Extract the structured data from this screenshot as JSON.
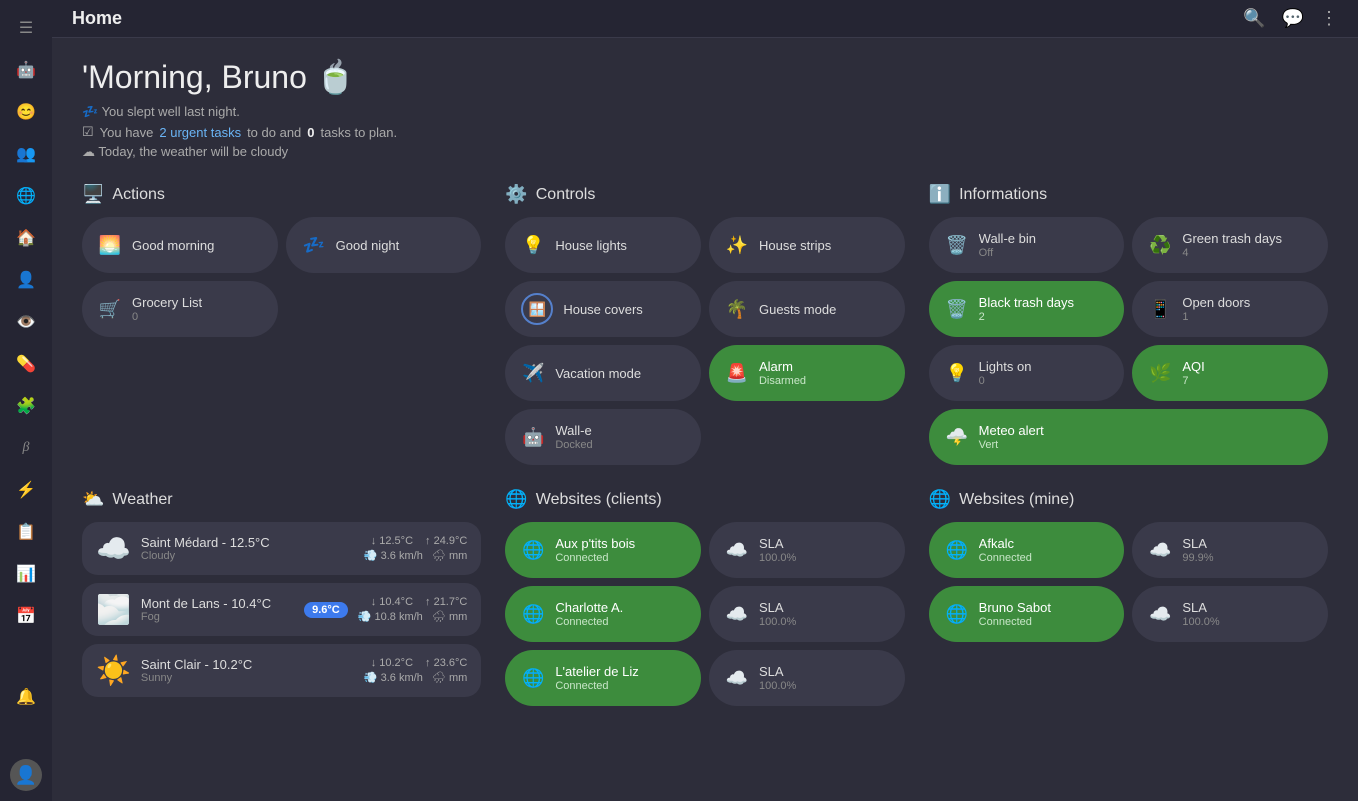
{
  "header": {
    "title": "Home"
  },
  "greeting": {
    "title": "'Morning, Bruno 🍵",
    "sleep_line": "💤 You slept well last night.",
    "tasks_line_prefix": "You have ",
    "tasks_link": "2 urgent tasks",
    "tasks_line_suffix": " to do and ",
    "tasks_count": "0",
    "tasks_line_end": " tasks to plan.",
    "weather_line": "☁ Today, the weather will be cloudy"
  },
  "sections": {
    "actions": {
      "title": "Actions",
      "tiles": [
        {
          "icon": "🌅",
          "label": "Good morning",
          "sublabel": "",
          "green": false
        },
        {
          "icon": "💤",
          "label": "Good night",
          "sublabel": "",
          "green": false
        },
        {
          "icon": "🛒",
          "label": "Grocery List",
          "sublabel": "0",
          "green": false
        }
      ]
    },
    "controls": {
      "title": "Controls",
      "tiles": [
        {
          "icon": "💡",
          "label": "House lights",
          "sublabel": "",
          "green": false,
          "ring": false
        },
        {
          "icon": "✨",
          "label": "House strips",
          "sublabel": "",
          "green": false,
          "ring": false
        },
        {
          "icon": "🪟",
          "label": "House covers",
          "sublabel": "",
          "green": false,
          "ring": true
        },
        {
          "icon": "🌴",
          "label": "Guests mode",
          "sublabel": "",
          "green": false,
          "ring": false
        },
        {
          "icon": "✈️",
          "label": "Vacation mode",
          "sublabel": "",
          "green": false,
          "ring": false
        },
        {
          "icon": "🚨",
          "label": "Alarm",
          "sublabel": "Disarmed",
          "green": true,
          "ring": false
        },
        {
          "icon": "🤖",
          "label": "Wall-e",
          "sublabel": "Docked",
          "green": false,
          "ring": false
        }
      ]
    },
    "informations": {
      "title": "Informations",
      "tiles": [
        {
          "icon": "🗑️",
          "label": "Wall-e bin",
          "sublabel": "Off",
          "green": false
        },
        {
          "icon": "♻️",
          "label": "Green trash days",
          "sublabel": "4",
          "green": false
        },
        {
          "icon": "🗑️",
          "label": "Black trash days",
          "sublabel": "2",
          "green": true
        },
        {
          "icon": "📱",
          "label": "Open doors",
          "sublabel": "1",
          "green": false
        },
        {
          "icon": "💡",
          "label": "Lights on",
          "sublabel": "0",
          "green": false
        },
        {
          "icon": "🌿",
          "label": "AQI",
          "sublabel": "7",
          "green": true
        },
        {
          "icon": "🌩️",
          "label": "Meteo alert",
          "sublabel": "Vert",
          "green": true
        }
      ]
    },
    "weather": {
      "title": "Weather",
      "items": [
        {
          "icon": "☁️",
          "name": "Saint Médard  - 12.5°C",
          "condition": "Cloudy",
          "badge": "",
          "temp_low": "12.5°C",
          "temp_high": "24.9°C",
          "wind": "3.6 km/h",
          "rain": "mm"
        },
        {
          "icon": "🌫️",
          "name": "Mont de Lans  - 10.4°C",
          "condition": "Fog",
          "badge": "9.6°C",
          "temp_low": "10.4°C",
          "temp_high": "21.7°C",
          "wind": "10.8 km/h",
          "rain": "mm"
        },
        {
          "icon": "☀️",
          "name": "Saint Clair  - 10.2°C",
          "condition": "Sunny",
          "badge": "",
          "temp_low": "10.2°C",
          "temp_high": "23.6°C",
          "wind": "3.6 km/h",
          "rain": "mm"
        }
      ]
    },
    "websites_clients": {
      "title": "Websites (clients)",
      "tiles": [
        {
          "icon": "🌐",
          "label": "Aux p'tits bois",
          "sublabel": "Connected",
          "green": true
        },
        {
          "icon": "☁️",
          "label": "SLA",
          "sublabel": "100.0%",
          "green": false
        },
        {
          "icon": "🌐",
          "label": "Charlotte A.",
          "sublabel": "Connected",
          "green": true
        },
        {
          "icon": "☁️",
          "label": "SLA",
          "sublabel": "100.0%",
          "green": false
        },
        {
          "icon": "🌐",
          "label": "L'atelier de Liz",
          "sublabel": "Connected",
          "green": true
        },
        {
          "icon": "☁️",
          "label": "SLA",
          "sublabel": "100.0%",
          "green": false
        }
      ]
    },
    "websites_mine": {
      "title": "Websites (mine)",
      "tiles": [
        {
          "icon": "🌐",
          "label": "Afkalc",
          "sublabel": "Connected",
          "green": true
        },
        {
          "icon": "☁️",
          "label": "SLA",
          "sublabel": "99.9%",
          "green": false
        },
        {
          "icon": "🌐",
          "label": "Bruno Sabot",
          "sublabel": "Connected",
          "green": true
        },
        {
          "icon": "☁️",
          "label": "SLA",
          "sublabel": "100.0%",
          "green": false
        }
      ]
    }
  },
  "sidebar": {
    "icons": [
      "☰",
      "🤖",
      "😊",
      "👥",
      "🌐",
      "🏠",
      "👤",
      "👁️",
      "💊",
      "🧩",
      "⚡",
      "📋",
      "📊",
      "📅",
      "🔔"
    ]
  }
}
